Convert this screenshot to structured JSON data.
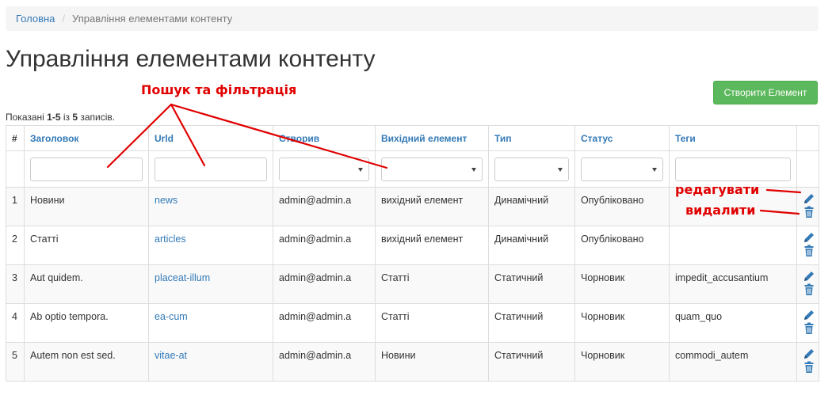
{
  "breadcrumb": {
    "home": "Головна",
    "separator": "/",
    "current": "Управління елементами контенту"
  },
  "page": {
    "title": "Управління елементами контенту",
    "create_button": "Створити Елемент"
  },
  "summary": {
    "prefix": "Показані ",
    "range": "1-5",
    "of": " із ",
    "total": "5",
    "suffix": " записів."
  },
  "table": {
    "columns": [
      "#",
      "Заголовок",
      "Urld",
      "Створив",
      "Вихідний елемент",
      "Тип",
      "Статус",
      "Теги"
    ],
    "rows": [
      {
        "num": "1",
        "title": "Новини",
        "url": "news",
        "author": "admin@admin.a",
        "parent": "вихідний елемент",
        "type": "Динамічний",
        "status": "Опубліковано",
        "tags": ""
      },
      {
        "num": "2",
        "title": "Статті",
        "url": "articles",
        "author": "admin@admin.a",
        "parent": "вихідний елемент",
        "type": "Динамічний",
        "status": "Опубліковано",
        "tags": ""
      },
      {
        "num": "3",
        "title": "Aut quidem.",
        "url": "placeat-illum",
        "author": "admin@admin.a",
        "parent": "Статті",
        "type": "Статичний",
        "status": "Чорновик",
        "tags": "impedit_accusantium"
      },
      {
        "num": "4",
        "title": "Ab optio tempora.",
        "url": "ea-cum",
        "author": "admin@admin.a",
        "parent": "Статті",
        "type": "Статичний",
        "status": "Чорновик",
        "tags": "quam_quo"
      },
      {
        "num": "5",
        "title": "Autem non est sed.",
        "url": "vitae-at",
        "author": "admin@admin.a",
        "parent": "Новини",
        "type": "Статичний",
        "status": "Чорновик",
        "tags": "commodi_autem"
      }
    ],
    "row_actions": [
      "pencil-icon",
      "trash-icon"
    ]
  },
  "annotations": {
    "search": "Пошук та фільтрація",
    "edit": "редагувати",
    "delete": "видалити",
    "color": "#e00000"
  },
  "colors": {
    "link": "#337ab7",
    "success": "#5cb85c",
    "breadcrumb_bg": "#f5f5f5"
  }
}
